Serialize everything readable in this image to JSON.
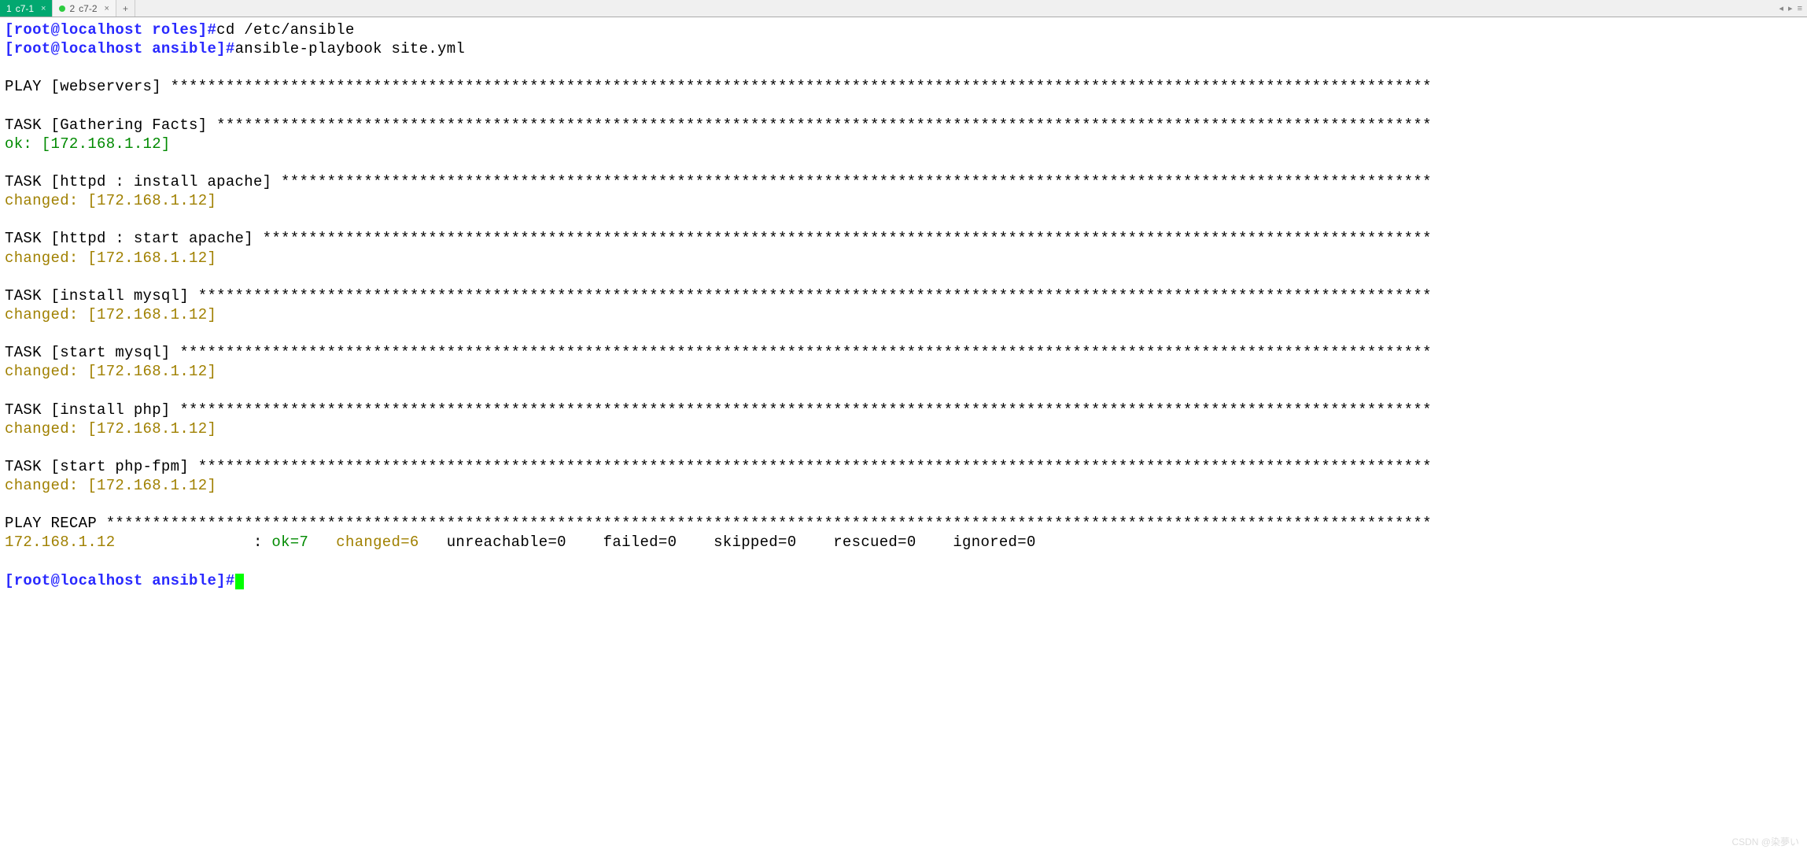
{
  "tabs": {
    "items": [
      {
        "num": "1",
        "label": "c7-1",
        "active": true,
        "modified": false
      },
      {
        "num": "2",
        "label": "c7-2",
        "active": false,
        "modified": true
      }
    ],
    "add": "+"
  },
  "nav": {
    "left": "◂",
    "right": "▸",
    "menu": "≡"
  },
  "prompt1": {
    "user_host": "[root@localhost roles]",
    "hash": "#",
    "cmd": "cd /etc/ansible"
  },
  "prompt2": {
    "user_host": "[root@localhost ansible]",
    "hash": "#",
    "cmd": "ansible-playbook site.yml"
  },
  "play_line": "PLAY [webservers] *****************************************************************************************************************************************",
  "tasks": [
    {
      "header": "TASK [Gathering Facts] ************************************************************************************************************************************",
      "status": {
        "text": "ok: [172.168.1.12]",
        "class": "green"
      }
    },
    {
      "header": "TASK [httpd : install apache] *****************************************************************************************************************************",
      "status": {
        "text": "changed: [172.168.1.12]",
        "class": "olive"
      }
    },
    {
      "header": "TASK [httpd : start apache] *******************************************************************************************************************************",
      "status": {
        "text": "changed: [172.168.1.12]",
        "class": "olive"
      }
    },
    {
      "header": "TASK [install mysql] **************************************************************************************************************************************",
      "status": {
        "text": "changed: [172.168.1.12]",
        "class": "olive"
      }
    },
    {
      "header": "TASK [start mysql] ****************************************************************************************************************************************",
      "status": {
        "text": "changed: [172.168.1.12]",
        "class": "olive"
      }
    },
    {
      "header": "TASK [install php] ****************************************************************************************************************************************",
      "status": {
        "text": "changed: [172.168.1.12]",
        "class": "olive"
      }
    },
    {
      "header": "TASK [start php-fpm] **************************************************************************************************************************************",
      "status": {
        "text": "changed: [172.168.1.12]",
        "class": "olive"
      }
    }
  ],
  "recap_header": "PLAY RECAP ************************************************************************************************************************************************",
  "recap": {
    "host": "172.168.1.12",
    "sep": "               : ",
    "ok": "ok=7   ",
    "changed": "changed=6   ",
    "rest": "unreachable=0    failed=0    skipped=0    rescued=0    ignored=0"
  },
  "prompt3": {
    "user_host": "[root@localhost ansible]",
    "hash": "#"
  },
  "watermark": "CSDN @染夢い"
}
